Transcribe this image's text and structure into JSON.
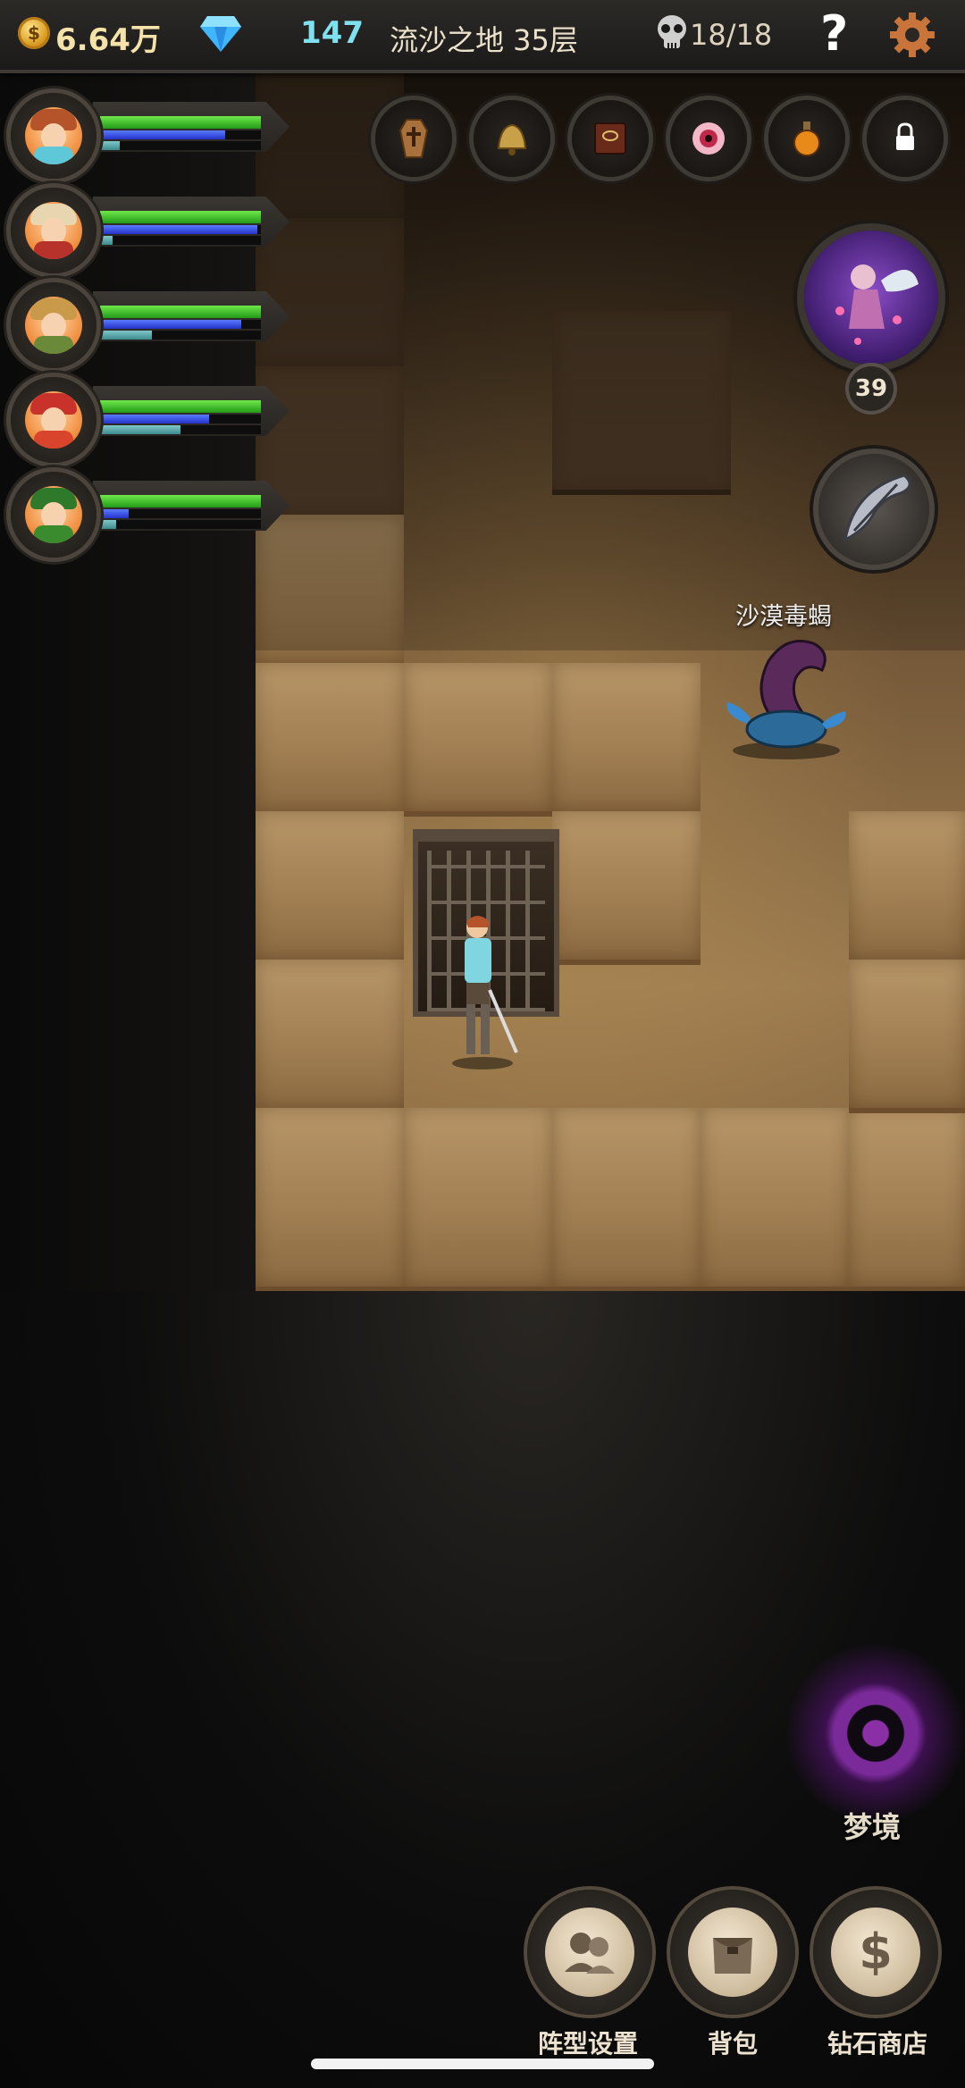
{
  "top_bar": {
    "gold": "6.64万",
    "gold_icon": "coin-icon",
    "gems": "147",
    "gem_icon": "diamond-icon",
    "floor": "流沙之地 35层",
    "kills": "18/18",
    "kills_icon": "skull-icon",
    "help": "?",
    "settings_icon": "gear-icon"
  },
  "party": [
    {
      "name": "hero-1",
      "hp": 1.0,
      "mp": 0.78,
      "xp": 0.12
    },
    {
      "name": "hero-2",
      "hp": 1.0,
      "mp": 0.98,
      "xp": 0.08
    },
    {
      "name": "hero-3",
      "hp": 1.0,
      "mp": 0.88,
      "xp": 0.32
    },
    {
      "name": "hero-4",
      "hp": 1.0,
      "mp": 0.68,
      "xp": 0.5
    },
    {
      "name": "hero-5",
      "hp": 1.0,
      "mp": 0.18,
      "xp": 0.1
    }
  ],
  "item_slots": [
    {
      "icon": "coffin-icon"
    },
    {
      "icon": "bell-icon"
    },
    {
      "icon": "book-icon"
    },
    {
      "icon": "eye-icon"
    },
    {
      "icon": "potion-icon"
    },
    {
      "icon": "lock-icon"
    }
  ],
  "boss": {
    "level": "39",
    "icon": "boss-portrait"
  },
  "feather_icon": "feather-icon",
  "enemy": {
    "label": "沙漠毒蝎"
  },
  "dream": {
    "label": "梦境"
  },
  "bottom_menu": [
    {
      "label": "阵型设置",
      "icon": "formation-icon"
    },
    {
      "label": "背包",
      "icon": "backpack-icon"
    },
    {
      "label": "钻石商店",
      "icon": "dollar-icon"
    }
  ],
  "colors": {
    "hp": "#3ec22c",
    "mp": "#3548e0",
    "xp": "#5aa8aa",
    "accent": "#7fe0f0",
    "portal": "#7a2a99"
  }
}
